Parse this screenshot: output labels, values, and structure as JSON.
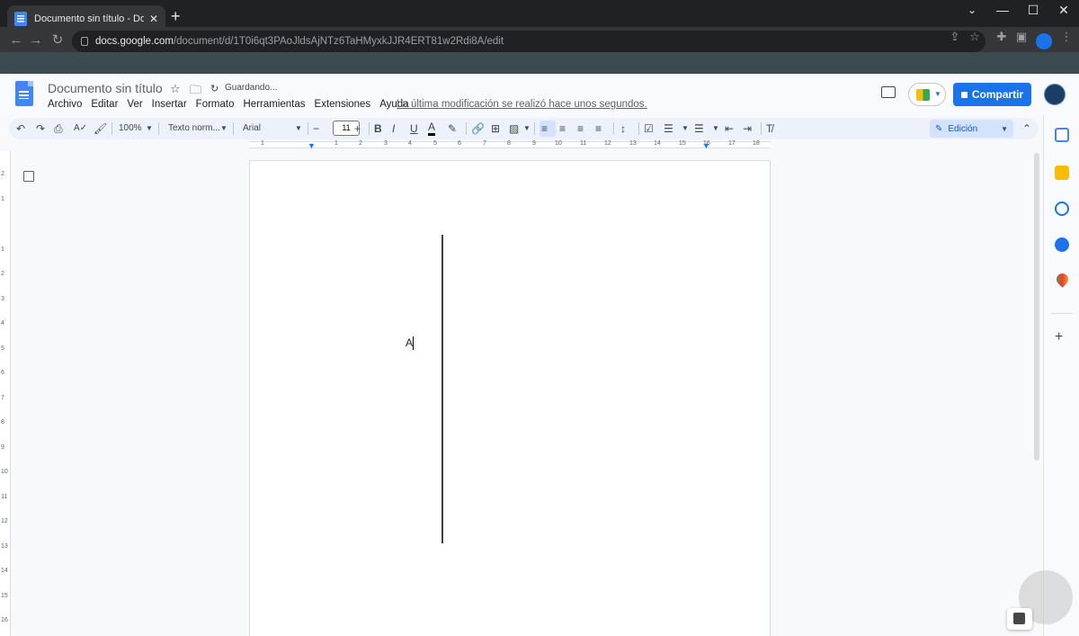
{
  "browser": {
    "tab_title": "Documento sin título - Documen",
    "tab_close": "✕",
    "new_tab": "+",
    "url_host": "docs.google.com",
    "url_path": "/document/d/1T0i6qt3PAoJldsAjNTz6TaHMyxkJJR4ERT81w2Rdi8A/edit",
    "win_min": "—",
    "win_max": "☐",
    "win_close": "✕",
    "win_chevron": "⌄"
  },
  "docs": {
    "title": "Documento sin título",
    "saving": "Guardando...",
    "menu": [
      "Archivo",
      "Editar",
      "Ver",
      "Insertar",
      "Formato",
      "Herramientas",
      "Extensiones",
      "Ayuda"
    ],
    "last_edit": "La última modificación se realizó hace unos segundos.",
    "share_label": "Compartir",
    "accent": "#1a73e8"
  },
  "toolbar": {
    "zoom": "100%",
    "style": "Texto norm...",
    "font": "Arial",
    "font_size": "11",
    "mode": "Edición"
  },
  "ruler": {
    "ticks": [
      "1",
      "1",
      "2",
      "3",
      "4",
      "5",
      "6",
      "7",
      "8",
      "9",
      "10",
      "11",
      "12",
      "13",
      "14",
      "15",
      "16",
      "17",
      "18"
    ],
    "vticks": [
      "2",
      "1",
      "1",
      "2",
      "3",
      "4",
      "5",
      "6",
      "7",
      "8",
      "9",
      "10",
      "11",
      "12",
      "13",
      "14",
      "15",
      "16"
    ]
  },
  "document": {
    "typed_text": "A"
  }
}
